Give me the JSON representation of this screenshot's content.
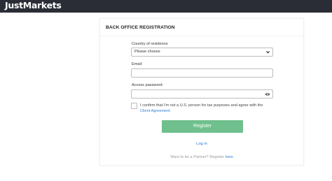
{
  "header": {
    "logo_text": "JustMarkets",
    "background": "#2b2d36"
  },
  "form": {
    "title": "BACK OFFICE REGISTRATION",
    "country": {
      "label": "Country of residence",
      "value": "Please choose"
    },
    "email": {
      "label": "Email:",
      "value": ""
    },
    "password": {
      "label": "Access password:",
      "value": ""
    },
    "consent": {
      "text": "I confirm that I'm not a U.S. person for tax purposes and agree with the",
      "link": "Client Agreement",
      "checked": false
    },
    "register_label": "Register",
    "login_label": "Log in",
    "partner_text": "Want to be a Partner? Register",
    "partner_link": "here"
  },
  "colors": {
    "accent_button": "#6fc08c",
    "link": "#2f7fd8"
  },
  "icons": {
    "select_arrow": "chevron-down-icon",
    "password_toggle": "eye-icon"
  }
}
